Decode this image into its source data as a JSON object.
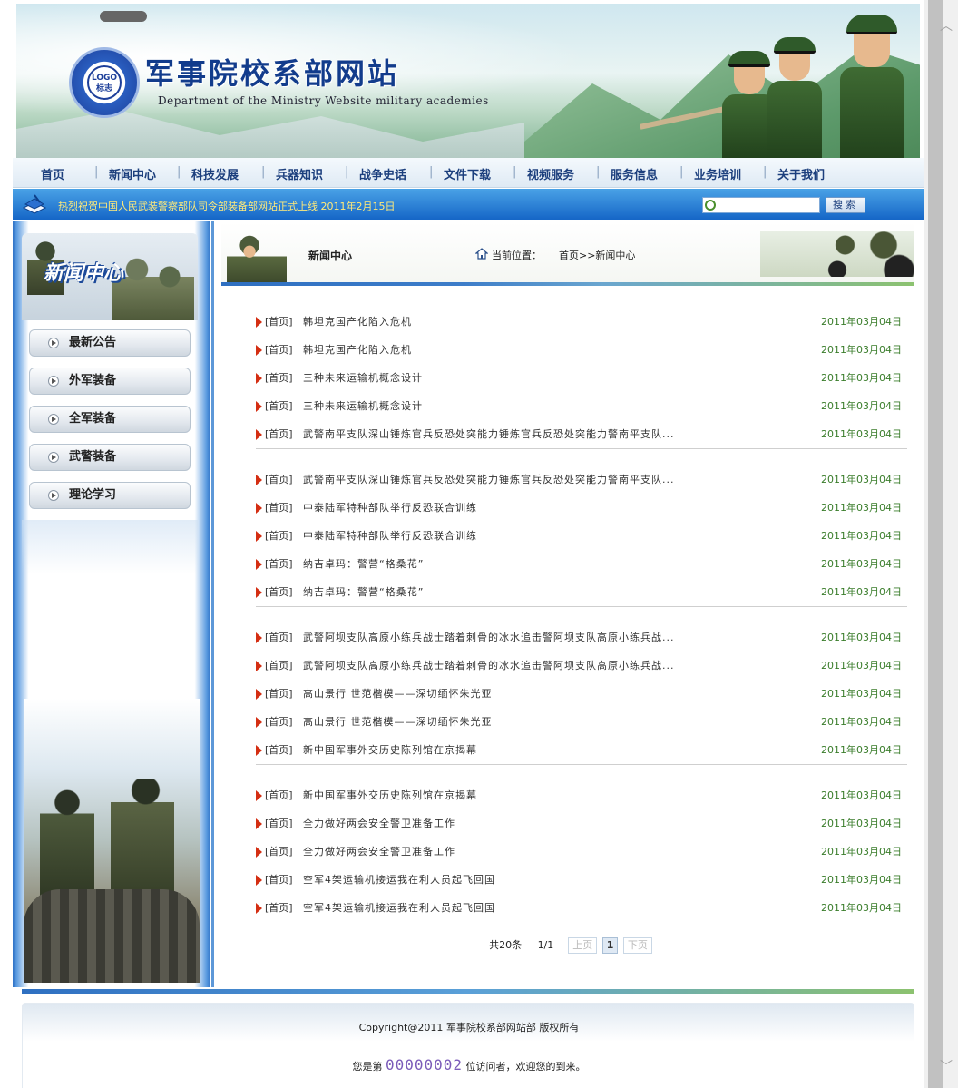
{
  "header": {
    "logo_top": "LOGO",
    "logo_bottom": "标志",
    "title": "军事院校系部网站",
    "subtitle": "Department of the Ministry Website military academies"
  },
  "nav": [
    "首页",
    "新闻中心",
    "科技发展",
    "兵器知识",
    "战争史话",
    "文件下载",
    "视频服务",
    "服务信息",
    "业务培训",
    "关于我们"
  ],
  "ticker": {
    "message": "热烈祝贺中国人民武装警察部队司令部装备部网站正式上线  2011年2月15日",
    "search_placeholder": "",
    "search_button": "搜索"
  },
  "sidebar": {
    "title": "新闻中心",
    "items": [
      "最新公告",
      "外军装备",
      "全军装备",
      "武警装备",
      "理论学习"
    ]
  },
  "main": {
    "section_title": "新闻中心",
    "crumb_label": "当前位置：",
    "crumb_path": "首页>>新闻中心",
    "groups": [
      [
        {
          "cat": "[首页]",
          "title": "韩坦克国产化陷入危机",
          "date": "2011年03月04日"
        },
        {
          "cat": "[首页]",
          "title": "韩坦克国产化陷入危机",
          "date": "2011年03月04日"
        },
        {
          "cat": "[首页]",
          "title": "三种未来运输机概念设计",
          "date": "2011年03月04日"
        },
        {
          "cat": "[首页]",
          "title": "三种未来运输机概念设计",
          "date": "2011年03月04日"
        },
        {
          "cat": "[首页]",
          "title": "武警南平支队深山锤炼官兵反恐处突能力锤炼官兵反恐处突能力警南平支队...",
          "date": "2011年03月04日"
        }
      ],
      [
        {
          "cat": "[首页]",
          "title": "武警南平支队深山锤炼官兵反恐处突能力锤炼官兵反恐处突能力警南平支队...",
          "date": "2011年03月04日"
        },
        {
          "cat": "[首页]",
          "title": "中泰陆军特种部队举行反恐联合训练",
          "date": "2011年03月04日"
        },
        {
          "cat": "[首页]",
          "title": "中泰陆军特种部队举行反恐联合训练",
          "date": "2011年03月04日"
        },
        {
          "cat": "[首页]",
          "title": "纳吉卓玛：警营“格桑花”",
          "date": "2011年03月04日"
        },
        {
          "cat": "[首页]",
          "title": "纳吉卓玛：警营“格桑花”",
          "date": "2011年03月04日"
        }
      ],
      [
        {
          "cat": "[首页]",
          "title": "武警阿坝支队高原小练兵战士踏着刺骨的冰水追击警阿坝支队高原小练兵战...",
          "date": "2011年03月04日"
        },
        {
          "cat": "[首页]",
          "title": "武警阿坝支队高原小练兵战士踏着刺骨的冰水追击警阿坝支队高原小练兵战...",
          "date": "2011年03月04日"
        },
        {
          "cat": "[首页]",
          "title": "高山景行 世范楷模——深切缅怀朱光亚",
          "date": "2011年03月04日"
        },
        {
          "cat": "[首页]",
          "title": "高山景行 世范楷模——深切缅怀朱光亚",
          "date": "2011年03月04日"
        },
        {
          "cat": "[首页]",
          "title": "新中国军事外交历史陈列馆在京揭幕",
          "date": "2011年03月04日"
        }
      ],
      [
        {
          "cat": "[首页]",
          "title": "新中国军事外交历史陈列馆在京揭幕",
          "date": "2011年03月04日"
        },
        {
          "cat": "[首页]",
          "title": "全力做好两会安全警卫准备工作",
          "date": "2011年03月04日"
        },
        {
          "cat": "[首页]",
          "title": "全力做好两会安全警卫准备工作",
          "date": "2011年03月04日"
        },
        {
          "cat": "[首页]",
          "title": "空军4架运输机接运我在利人员起飞回国",
          "date": "2011年03月04日"
        },
        {
          "cat": "[首页]",
          "title": "空军4架运输机接运我在利人员起飞回国",
          "date": "2011年03月04日"
        }
      ]
    ],
    "pager": {
      "total": "共20条",
      "pages": "1/1",
      "prev": "上页",
      "current": "1",
      "next": "下页"
    }
  },
  "footer": {
    "copyright": "Copyright@2011 军事院校系部网站部 版权所有",
    "visit_prefix": "您是第",
    "visit_count": "00000002",
    "visit_suffix": "位访问者，欢迎您的到来。"
  }
}
